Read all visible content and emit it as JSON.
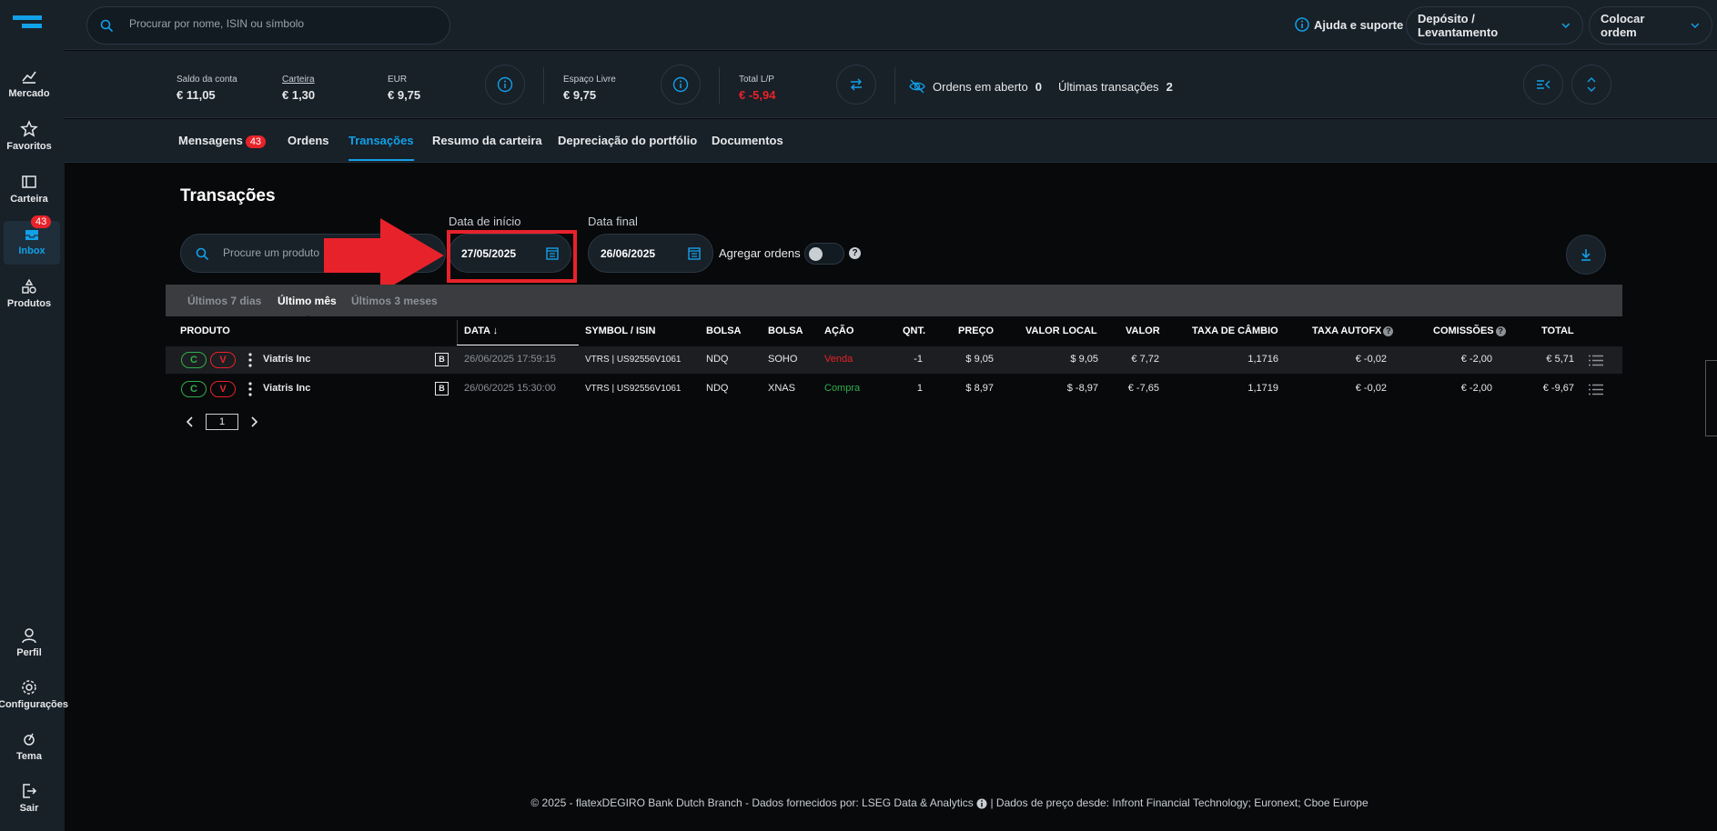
{
  "search": {
    "placeholder": "Procurar por nome, ISIN ou símbolo"
  },
  "header": {
    "help": "Ajuda e suporte",
    "deposit": "Depósito / Levantamento",
    "order": "Colocar ordem"
  },
  "nav": [
    {
      "label": "Mercado",
      "icon": "chart-icon"
    },
    {
      "label": "Favoritos",
      "icon": "star-icon"
    },
    {
      "label": "Carteira",
      "icon": "portfolio-icon"
    },
    {
      "label": "Inbox",
      "icon": "inbox-icon",
      "badge": "43"
    },
    {
      "label": "Produtos",
      "icon": "products-icon"
    },
    {
      "label": "Perfil",
      "icon": "user-icon"
    },
    {
      "label": "Configurações",
      "icon": "gear-icon"
    },
    {
      "label": "Tema",
      "icon": "theme-icon"
    },
    {
      "label": "Sair",
      "icon": "logout-icon"
    }
  ],
  "summary": {
    "balance_label": "Saldo da conta",
    "balance": "€ 11,05",
    "portfolio_label": "Carteira",
    "portfolio": "€ 1,30",
    "eur_label": "EUR",
    "eur": "€ 9,75",
    "free_label": "Espaço Livre",
    "free": "€ 9,75",
    "pl_label": "Total L/P",
    "pl": "€ -5,94",
    "open_orders_label": "Ordens em aberto",
    "open_orders": "0",
    "last_tx_label": "Últimas transações",
    "last_tx": "2"
  },
  "tabs": [
    {
      "label": "Mensagens",
      "badge": "43"
    },
    {
      "label": "Ordens"
    },
    {
      "label": "Transações"
    },
    {
      "label": "Resumo da carteira"
    },
    {
      "label": "Depreciação do portfólio"
    },
    {
      "label": "Documentos"
    }
  ],
  "page": {
    "title": "Transações",
    "product_placeholder": "Procure um produto",
    "start_label": "Data de início",
    "start_date": "27/05/2025",
    "end_label": "Data final",
    "end_date": "26/06/2025",
    "aggregate_label": "Agregar ordens",
    "periods": [
      "Últimos 7 dias",
      "Último mês",
      "Últimos 3 meses"
    ]
  },
  "table": {
    "headers": {
      "product": "PRODUTO",
      "date": "DATA ↓",
      "symbol": "SYMBOL / ISIN",
      "bolsa1": "BOLSA",
      "bolsa2": "BOLSA",
      "action": "AÇÃO",
      "qty": "QNT.",
      "price": "PREÇO",
      "local": "VALOR LOCAL",
      "value": "VALOR",
      "fx": "TAXA DE CÂMBIO",
      "autofx": "TAXA AUTOFX",
      "fees": "COMISSÕES",
      "total": "TOTAL"
    },
    "rows": [
      {
        "c": "C",
        "v": "V",
        "product": "Viatris Inc",
        "b": "B",
        "date": "26/06/2025 17:59:15",
        "symbol": "VTRS | US92556V1061",
        "bolsa1": "NDQ",
        "bolsa2": "SOHO",
        "action": "Venda",
        "qty": "-1",
        "price": "$ 9,05",
        "local": "$ 9,05",
        "value": "€ 7,72",
        "fx": "1,1716",
        "autofx": "€ -0,02",
        "fees": "€ -2,00",
        "total": "€ 5,71"
      },
      {
        "c": "C",
        "v": "V",
        "product": "Viatris Inc",
        "b": "B",
        "date": "26/06/2025 15:30:00",
        "symbol": "VTRS | US92556V1061",
        "bolsa1": "NDQ",
        "bolsa2": "XNAS",
        "action": "Compra",
        "qty": "1",
        "price": "$ 8,97",
        "local": "$ -8,97",
        "value": "€ -7,65",
        "fx": "1,1719",
        "autofx": "€ -0,02",
        "fees": "€ -2,00",
        "total": "€ -9,67"
      }
    ]
  },
  "pager": {
    "page": "1"
  },
  "footer": {
    "part1": "© 2025 - flatexDEGIRO Bank Dutch Branch - Dados fornecidos por: LSEG Data & Analytics",
    "part2": "| Dados de preço desde: Infront Financial Technology; Euronext; Cboe Europe"
  },
  "colors": {
    "accent": "#12a0e8",
    "sell": "#e8222a",
    "buy": "#2fae4d",
    "background": "#08090b",
    "panel": "#182028"
  }
}
